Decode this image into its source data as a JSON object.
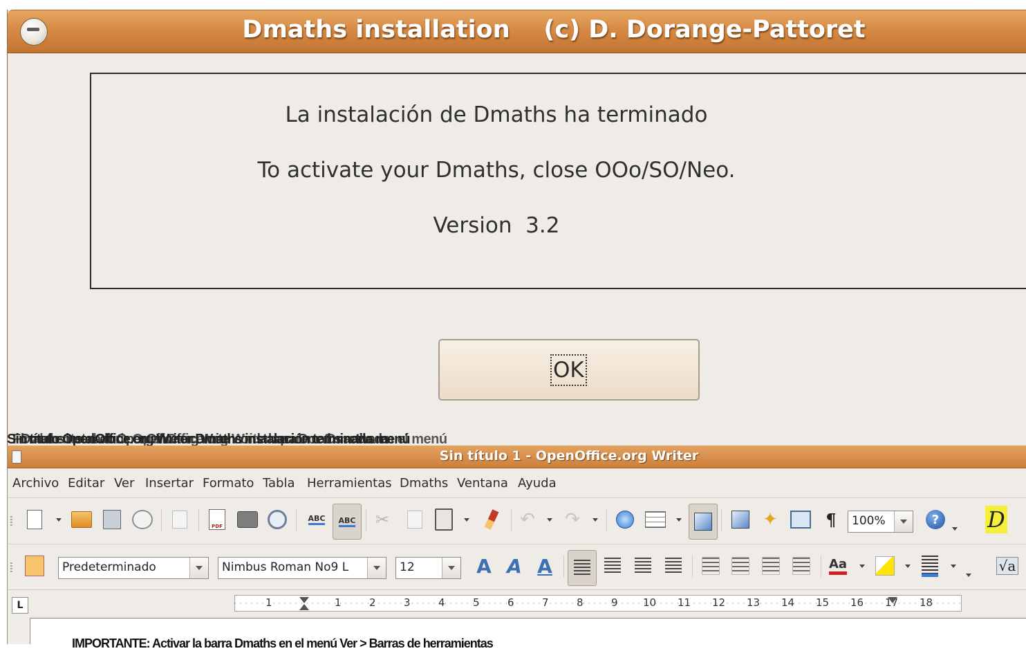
{
  "dialog": {
    "title": "Dmaths installation    (c) D. Dorange-Pattoret",
    "lines": [
      "La instalación de Dmaths ha terminado",
      "To activate your Dmaths, close OOo/SO/Neo.",
      "Version  3.2"
    ],
    "ok_label": "OK"
  },
  "overlap_caption": [
    "Sin título OpenOffice.org Writer Dmaths instalación terminada menú",
    "Dmaths instalado OpenOffice.org Writer con la barra Dmaths activada",
    "Finalmente al abrir OpenOffice.org Writer aparece Dmaths en el menú"
  ],
  "writer": {
    "title": "Sin título 1 - OpenOffice.org Writer",
    "menu": [
      "Archivo",
      "Editar",
      "Ver",
      "Insertar",
      "Formato",
      "Tabla",
      "Herramientas",
      "Dmaths",
      "Ventana",
      "Ayuda"
    ],
    "zoom": "100%",
    "paragraph_style": "Predeterminado",
    "font_name": "Nimbus Roman No9 L",
    "font_size": "12",
    "ruler_labels": [
      "1",
      "1",
      "2",
      "3",
      "4",
      "5",
      "6",
      "7",
      "8",
      "9",
      "10",
      "11",
      "12",
      "13",
      "14",
      "15",
      "16",
      "17",
      "18"
    ],
    "tab_type": "L",
    "bottom_text": "IMPORTANTE: Activar la barra Dmaths en el menú Ver > Barras de herramientas"
  },
  "icons": {
    "dialog_menu": "window-menu-icon",
    "writer_doc": "document-icon",
    "help": "help-icon",
    "dmaths": "dmaths-D-icon",
    "sqrt": "dmaths-sqrt-icon"
  },
  "colors": {
    "titlebar": "#d68a45",
    "window_bg": "#efebe7",
    "dmaths_yellow": "#f5ef3a"
  }
}
